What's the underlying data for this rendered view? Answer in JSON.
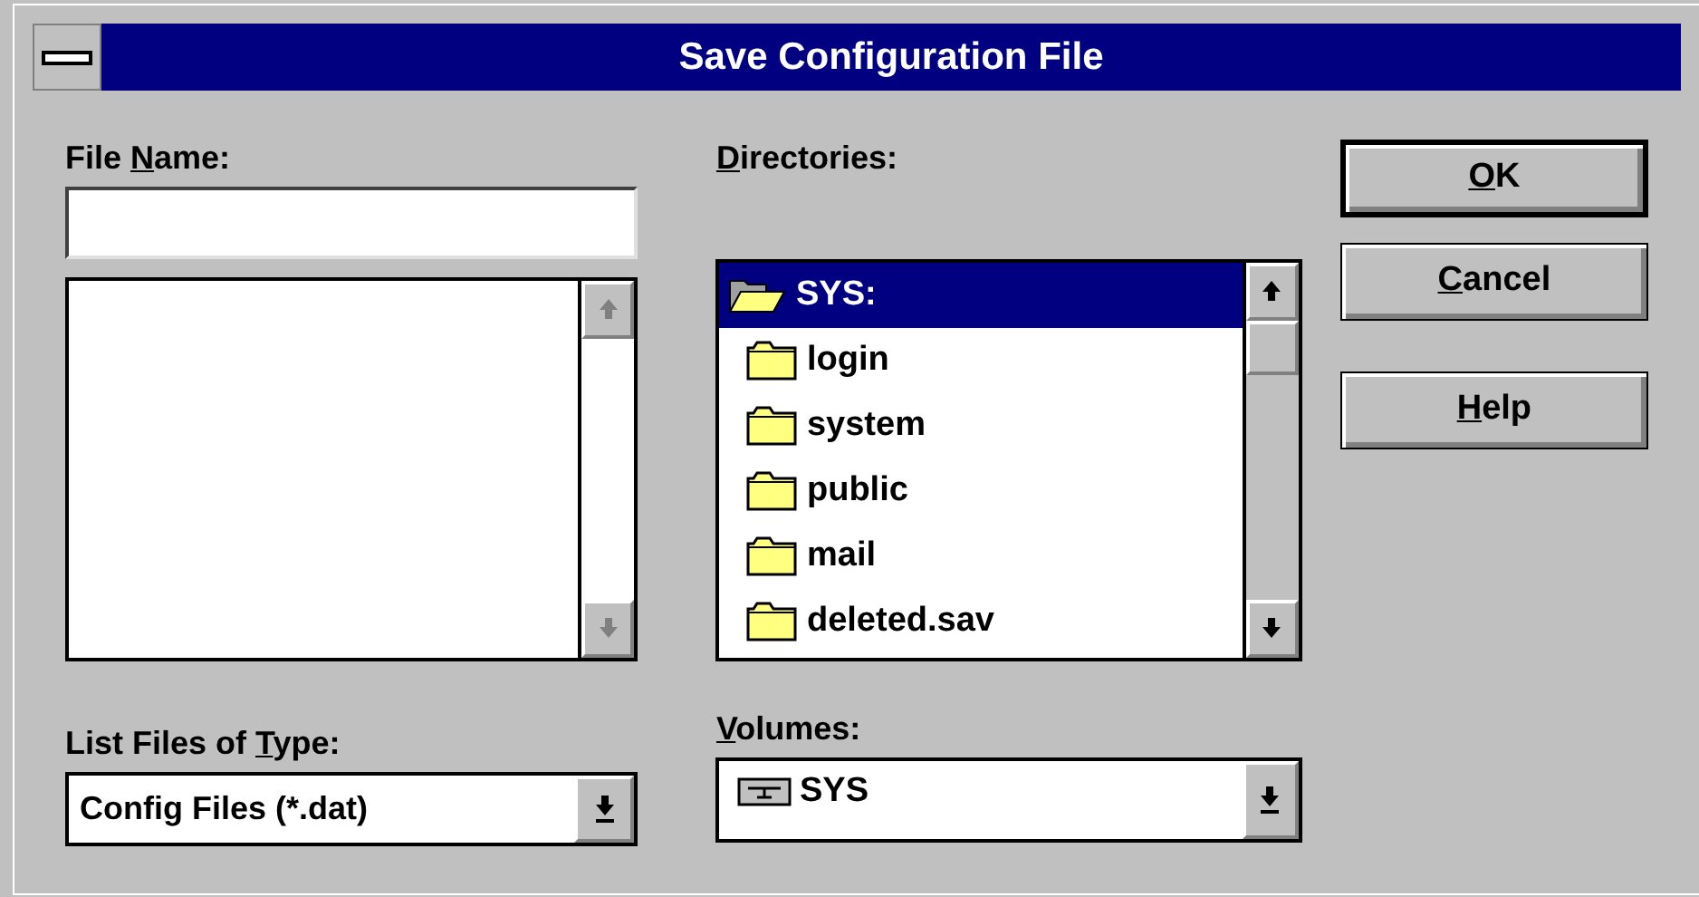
{
  "window": {
    "title": "Save Configuration File"
  },
  "file_name": {
    "label_parts": {
      "before": "File ",
      "key": "N",
      "after": "ame:"
    }
  },
  "files_list": {
    "scroll_enabled": false
  },
  "file_type": {
    "label_parts": {
      "before": "List Files of ",
      "key": "T",
      "after": "ype:"
    },
    "value": "Config Files (*.dat)"
  },
  "directories": {
    "label_parts": {
      "key": "D",
      "after": "irectories:"
    },
    "items": [
      {
        "name": "SYS:",
        "kind": "open",
        "selected": true
      },
      {
        "name": "login",
        "kind": "closed",
        "selected": false
      },
      {
        "name": "system",
        "kind": "closed",
        "selected": false
      },
      {
        "name": "public",
        "kind": "closed",
        "selected": false
      },
      {
        "name": "mail",
        "kind": "closed",
        "selected": false
      },
      {
        "name": "deleted.sav",
        "kind": "closed",
        "selected": false
      }
    ]
  },
  "volumes": {
    "label_parts": {
      "key": "V",
      "after": "olumes:"
    },
    "value": "SYS"
  },
  "buttons": [
    {
      "label_parts": {
        "key": "O",
        "after": "K"
      },
      "default": true
    },
    {
      "label_parts": {
        "key": "C",
        "after": "ancel"
      },
      "default": false
    },
    {
      "label_parts": {
        "key": "H",
        "after": "elp"
      },
      "default": false
    }
  ]
}
